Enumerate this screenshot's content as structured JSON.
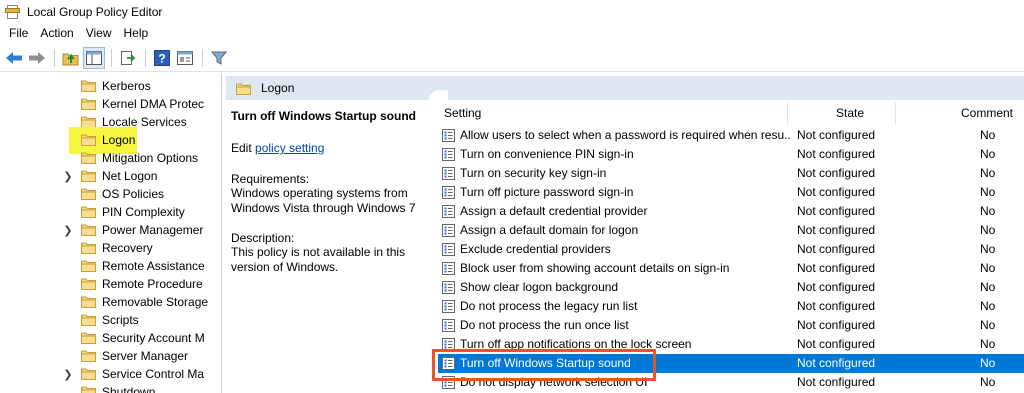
{
  "window": {
    "title": "Local Group Policy Editor"
  },
  "menu": [
    "File",
    "Action",
    "View",
    "Help"
  ],
  "toolbar": {
    "icons": [
      "back-arrow-icon",
      "forward-arrow-icon",
      "up-folder-icon",
      "show-hide-tree-icon",
      "export-list-icon",
      "help-icon",
      "properties-icon",
      "filter-icon"
    ]
  },
  "tree": {
    "items": [
      {
        "label": "Kerberos",
        "expandable": false
      },
      {
        "label": "Kernel DMA Protec",
        "expandable": false
      },
      {
        "label": "Locale Services",
        "expandable": false
      },
      {
        "label": "Logon",
        "expandable": false,
        "selected": true
      },
      {
        "label": "Mitigation Options",
        "expandable": false
      },
      {
        "label": "Net Logon",
        "expandable": true
      },
      {
        "label": "OS Policies",
        "expandable": false
      },
      {
        "label": "PIN Complexity",
        "expandable": false
      },
      {
        "label": "Power Managemer",
        "expandable": true
      },
      {
        "label": "Recovery",
        "expandable": false
      },
      {
        "label": "Remote Assistance",
        "expandable": false
      },
      {
        "label": "Remote Procedure",
        "expandable": false
      },
      {
        "label": "Removable Storage",
        "expandable": false
      },
      {
        "label": "Scripts",
        "expandable": false
      },
      {
        "label": "Security Account M",
        "expandable": false
      },
      {
        "label": "Server Manager",
        "expandable": false
      },
      {
        "label": "Service Control Ma",
        "expandable": true
      },
      {
        "label": "Shutdown",
        "expandable": false
      }
    ]
  },
  "details": {
    "header": "Logon",
    "description": {
      "title": "Turn off Windows Startup sound",
      "edit_prefix": "Edit ",
      "edit_link": "policy setting",
      "requirements_label": "Requirements:",
      "requirements_text": "Windows operating systems from Windows Vista through Windows 7",
      "description_label": "Description:",
      "description_text": "This policy is not available in this version of Windows."
    },
    "columns": {
      "setting": "Setting",
      "state": "State",
      "comment": "Comment"
    },
    "rows": [
      {
        "setting": "Allow users to select when a password is required when resu...",
        "state": "Not configured",
        "comment": "No"
      },
      {
        "setting": "Turn on convenience PIN sign-in",
        "state": "Not configured",
        "comment": "No"
      },
      {
        "setting": "Turn on security key sign-in",
        "state": "Not configured",
        "comment": "No"
      },
      {
        "setting": "Turn off picture password sign-in",
        "state": "Not configured",
        "comment": "No"
      },
      {
        "setting": "Assign a default credential provider",
        "state": "Not configured",
        "comment": "No"
      },
      {
        "setting": "Assign a default domain for logon",
        "state": "Not configured",
        "comment": "No"
      },
      {
        "setting": "Exclude credential providers",
        "state": "Not configured",
        "comment": "No"
      },
      {
        "setting": "Block user from showing account details on sign-in",
        "state": "Not configured",
        "comment": "No"
      },
      {
        "setting": "Show clear logon background",
        "state": "Not configured",
        "comment": "No"
      },
      {
        "setting": "Do not process the legacy run list",
        "state": "Not configured",
        "comment": "No"
      },
      {
        "setting": "Do not process the run once list",
        "state": "Not configured",
        "comment": "No"
      },
      {
        "setting": "Turn off app notifications on the lock screen",
        "state": "Not configured",
        "comment": "No"
      },
      {
        "setting": "Turn off Windows Startup sound",
        "state": "Not configured",
        "comment": "No",
        "selected": true
      },
      {
        "setting": "Do not display network selection UI",
        "state": "Not configured",
        "comment": "No"
      }
    ]
  },
  "colors": {
    "selection": "#0078d7",
    "tree_highlight": "#f5f542",
    "callout_border": "#e8542b",
    "header_band": "#dfe7f1",
    "link": "#0645ad"
  }
}
